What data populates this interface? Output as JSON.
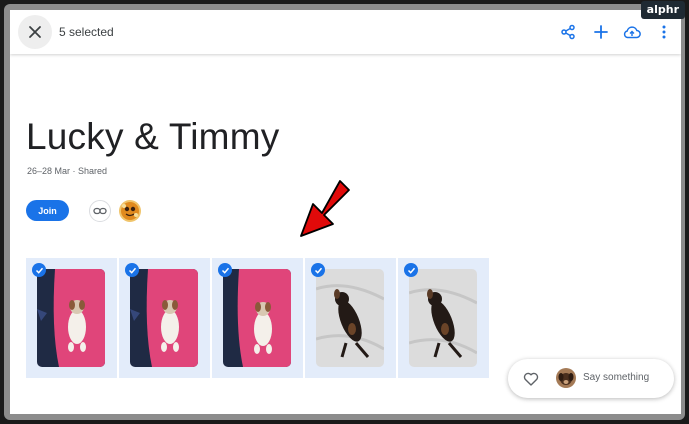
{
  "watermark": "alphr",
  "toolbar": {
    "selected_label": "5 selected",
    "icons": [
      "close-icon",
      "share-icon",
      "add-icon",
      "cloud-upload-icon",
      "more-vert-icon"
    ]
  },
  "album": {
    "title": "Lucky & Timmy",
    "meta": "26–28 Mar · Shared",
    "join_label": "Join"
  },
  "photos": [
    {
      "subject": "puppy-on-red-blanket",
      "selected": true
    },
    {
      "subject": "puppy-on-red-blanket",
      "selected": true
    },
    {
      "subject": "puppy-on-red-blanket",
      "selected": true
    },
    {
      "subject": "black-puppy-on-white-blanket",
      "selected": true
    },
    {
      "subject": "black-puppy-on-white-blanket",
      "selected": true
    }
  ],
  "comment": {
    "placeholder": "Say something"
  },
  "colors": {
    "accent": "#1a73e8",
    "tile_selected_bg": "#e3ecfa",
    "arrow": "#e10a0a"
  }
}
